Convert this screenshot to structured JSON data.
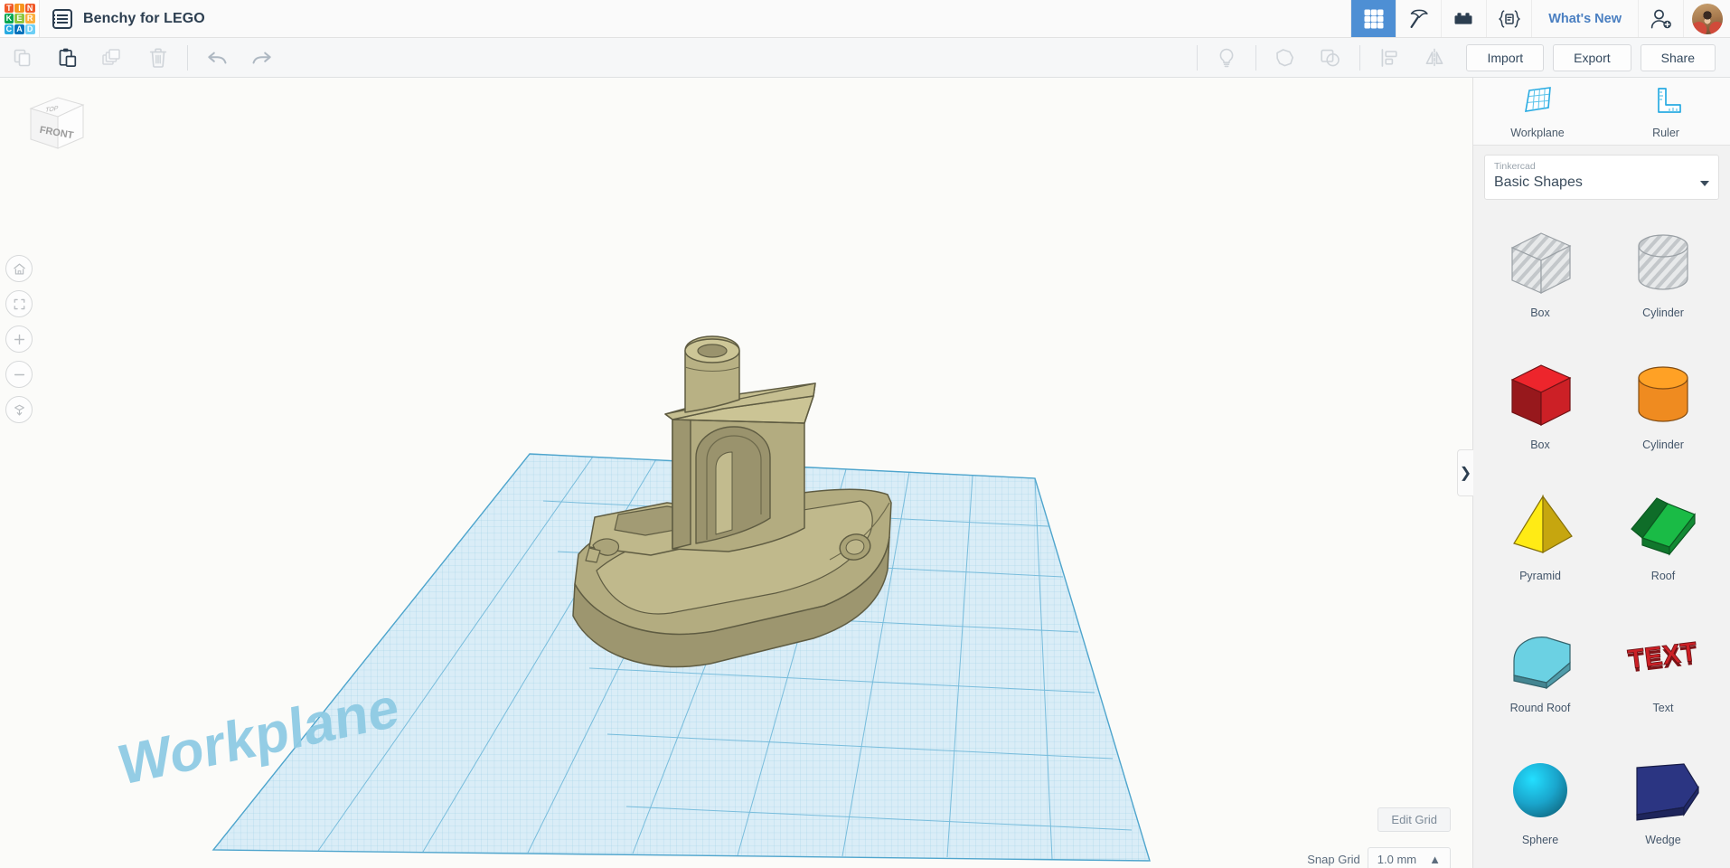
{
  "app": {
    "logo_letters": [
      "T",
      "I",
      "N",
      "K",
      "E",
      "R",
      "C",
      "A",
      "D"
    ],
    "logo_colors": [
      "#f05a28",
      "#f7941e",
      "#f15a29",
      "#00a651",
      "#8dc63f",
      "#fbb040",
      "#29abe2",
      "#0072bc",
      "#6dcff6"
    ],
    "document_title": "Benchy for LEGO",
    "menu_icon": "list-icon"
  },
  "topbar": {
    "icons": [
      {
        "name": "grid-view-icon",
        "label": "Grid view",
        "active": true
      },
      {
        "name": "minecraft-pickaxe-icon",
        "label": "Minecraft",
        "active": false
      },
      {
        "name": "lego-brick-icon",
        "label": "Bricks",
        "active": false
      },
      {
        "name": "codeblocks-icon",
        "label": "Codeblocks",
        "active": false
      }
    ],
    "whats_new_label": "What's New",
    "invite_icon": "add-person-icon",
    "avatar_label": "User avatar"
  },
  "toolbar": {
    "left_icons": [
      {
        "name": "copy-icon",
        "label": "Copy",
        "enabled": false
      },
      {
        "name": "paste-icon",
        "label": "Paste",
        "enabled": true
      },
      {
        "name": "duplicate-icon",
        "label": "Duplicate",
        "enabled": false
      },
      {
        "name": "delete-icon",
        "label": "Delete",
        "enabled": false
      }
    ],
    "history_icons": [
      {
        "name": "undo-icon",
        "label": "Undo",
        "enabled": true
      },
      {
        "name": "redo-icon",
        "label": "Redo",
        "enabled": true
      }
    ],
    "right_icons": [
      {
        "name": "notes-lightbulb-icon",
        "label": "Notes",
        "enabled": false
      },
      {
        "name": "group-icon",
        "label": "Group",
        "enabled": false
      },
      {
        "name": "ungroup-icon",
        "label": "Ungroup",
        "enabled": false
      },
      {
        "name": "align-icon",
        "label": "Align",
        "enabled": false
      },
      {
        "name": "mirror-icon",
        "label": "Mirror",
        "enabled": false
      }
    ],
    "import_label": "Import",
    "export_label": "Export",
    "share_label": "Share"
  },
  "viewport": {
    "viewcube": {
      "top_face": "TOP",
      "front_face": "FRONT"
    },
    "nav_buttons": [
      {
        "name": "home-view-button",
        "label": "Home view"
      },
      {
        "name": "fit-to-view-button",
        "label": "Fit all in view"
      },
      {
        "name": "zoom-in-button",
        "label": "Zoom in"
      },
      {
        "name": "zoom-out-button",
        "label": "Zoom out"
      },
      {
        "name": "perspective-toggle-button",
        "label": "Switch to orthographic view"
      }
    ],
    "workplane_label": "Workplane",
    "edit_grid_label": "Edit Grid",
    "snap_grid_label": "Snap Grid",
    "snap_grid_value": "1.0 mm",
    "model_name": "3DBenchy boat",
    "model_color": "#b7b083",
    "grid_color": "#6fb8d8",
    "grid_fill": "#d6ebf6"
  },
  "panel": {
    "tools": [
      {
        "name": "workplane-tool",
        "label": "Workplane",
        "icon": "workplane-icon"
      },
      {
        "name": "ruler-tool",
        "label": "Ruler",
        "icon": "ruler-icon"
      }
    ],
    "library_brand": "Tinkercad",
    "library_name": "Basic Shapes",
    "collapse_icon": "chevron-right-icon",
    "shapes": [
      {
        "label": "Box",
        "kind": "box-hole",
        "color": "#cfd2d5"
      },
      {
        "label": "Cylinder",
        "kind": "cylinder-hole",
        "color": "#cfd2d5"
      },
      {
        "label": "Box",
        "kind": "box",
        "color": "#cc2026"
      },
      {
        "label": "Cylinder",
        "kind": "cylinder",
        "color": "#ef8b20"
      },
      {
        "label": "Pyramid",
        "kind": "pyramid",
        "color": "#f2cb12"
      },
      {
        "label": "Roof",
        "kind": "roof",
        "color": "#16a13c"
      },
      {
        "label": "Round Roof",
        "kind": "round-roof",
        "color": "#5cb4c4"
      },
      {
        "label": "Text",
        "kind": "text",
        "color": "#cc2026"
      },
      {
        "label": "Sphere",
        "kind": "sphere",
        "color": "#1aa5cc"
      },
      {
        "label": "Wedge",
        "kind": "wedge",
        "color": "#2b3582"
      }
    ]
  }
}
